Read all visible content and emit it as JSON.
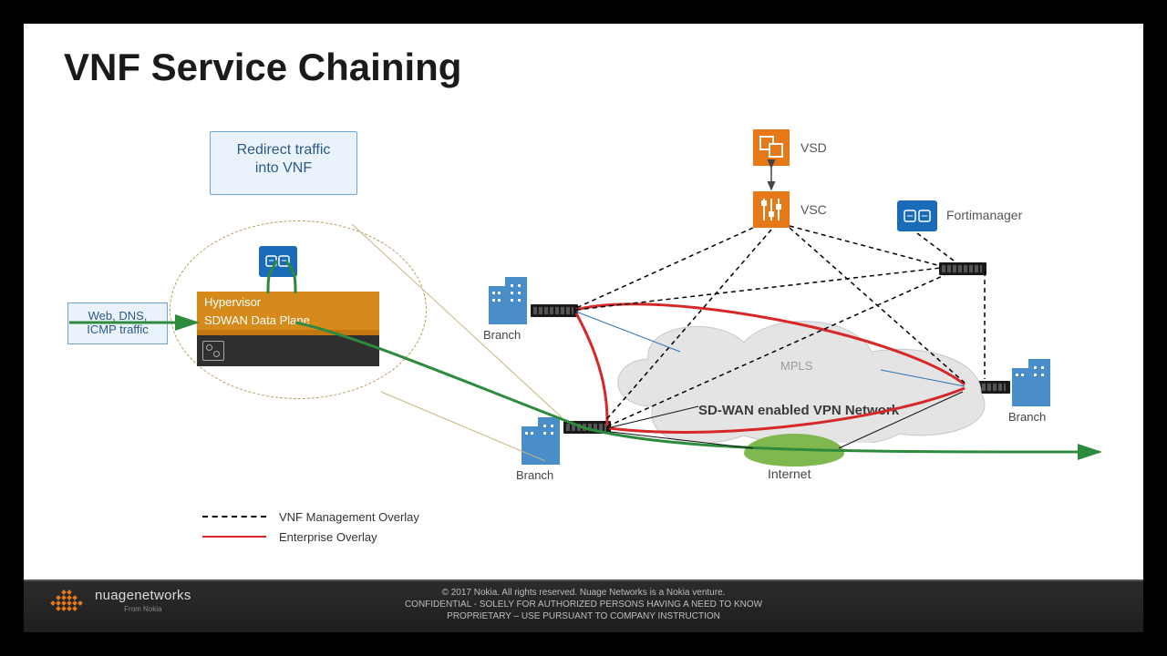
{
  "title": "VNF Service Chaining",
  "callout": {
    "line1": "Redirect traffic",
    "line2": "into VNF"
  },
  "traffic": {
    "line1": "Web, DNS,",
    "line2": "ICMP traffic"
  },
  "hypervisor": {
    "line1": "Hypervisor",
    "line2": "SDWAN Data Plane"
  },
  "nodes": {
    "branch1": "Branch",
    "branch2": "Branch",
    "branch3": "Branch",
    "vsd": "VSD",
    "vsc": "VSC",
    "fortimanager": "Fortimanager"
  },
  "clouds": {
    "sdwan": "SD-WAN enabled VPN Network",
    "mpls": "MPLS",
    "internet": "Internet"
  },
  "legend": {
    "mgmt": "VNF Management Overlay",
    "enterprise": "Enterprise Overlay"
  },
  "footer": {
    "line1": "© 2017 Nokia. All rights reserved. Nuage Networks is a Nokia venture.",
    "line2": "CONFIDENTIAL - SOLELY FOR AUTHORIZED PERSONS HAVING A NEED TO KNOW",
    "line3": "PROPRIETARY – USE PURSUANT TO COMPANY INSTRUCTION",
    "brand": "nuagenetworks",
    "brand_sub": "From Nokia"
  },
  "colors": {
    "accent_orange": "#e67817",
    "accent_blue": "#1a6bb8",
    "red": "#d62828",
    "green": "#2e8b3d"
  }
}
